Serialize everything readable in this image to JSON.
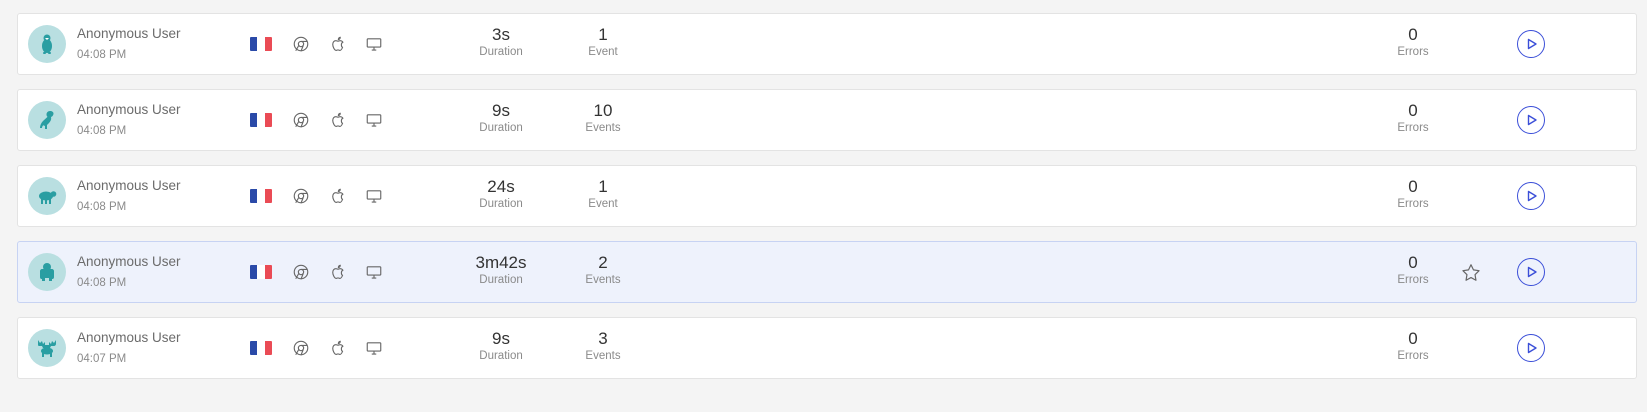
{
  "colors": {
    "avatar_bg": "#b9dfe1",
    "avatar_fg": "#2a9ea2",
    "play_accent": "#3b4fd8",
    "flag_blue": "#2a4aa8",
    "flag_white": "#ffffff",
    "flag_red": "#ea4b55",
    "icon_gray": "#666666",
    "highlight_bg": "#eef2fc"
  },
  "sessions": [
    {
      "avatar_icon": "penguin-icon",
      "user": "Anonymous User",
      "time": "04:08 PM",
      "country_flag": "france-flag",
      "browser_icon": "chrome-icon",
      "os_icon": "apple-icon",
      "device_icon": "desktop-icon",
      "duration": "3s",
      "duration_label": "Duration",
      "events": "1",
      "events_label": "Event",
      "errors": "0",
      "errors_label": "Errors",
      "highlighted": false,
      "starred_visible": false
    },
    {
      "avatar_icon": "bird-icon",
      "user": "Anonymous User",
      "time": "04:08 PM",
      "country_flag": "france-flag",
      "browser_icon": "chrome-icon",
      "os_icon": "apple-icon",
      "device_icon": "desktop-icon",
      "duration": "9s",
      "duration_label": "Duration",
      "events": "10",
      "events_label": "Events",
      "errors": "0",
      "errors_label": "Errors",
      "highlighted": false,
      "starred_visible": false
    },
    {
      "avatar_icon": "sheep-icon",
      "user": "Anonymous User",
      "time": "04:08 PM",
      "country_flag": "france-flag",
      "browser_icon": "chrome-icon",
      "os_icon": "apple-icon",
      "device_icon": "desktop-icon",
      "duration": "24s",
      "duration_label": "Duration",
      "events": "1",
      "events_label": "Event",
      "errors": "0",
      "errors_label": "Errors",
      "highlighted": false,
      "starred_visible": false
    },
    {
      "avatar_icon": "gorilla-icon",
      "user": "Anonymous User",
      "time": "04:08 PM",
      "country_flag": "france-flag",
      "browser_icon": "chrome-icon",
      "os_icon": "apple-icon",
      "device_icon": "desktop-icon",
      "duration": "3m42s",
      "duration_label": "Duration",
      "events": "2",
      "events_label": "Events",
      "errors": "0",
      "errors_label": "Errors",
      "highlighted": true,
      "starred_visible": true
    },
    {
      "avatar_icon": "moose-icon",
      "user": "Anonymous User",
      "time": "04:07 PM",
      "country_flag": "france-flag",
      "browser_icon": "chrome-icon",
      "os_icon": "apple-icon",
      "device_icon": "desktop-icon",
      "duration": "9s",
      "duration_label": "Duration",
      "events": "3",
      "events_label": "Events",
      "errors": "0",
      "errors_label": "Errors",
      "highlighted": false,
      "starred_visible": false
    }
  ]
}
